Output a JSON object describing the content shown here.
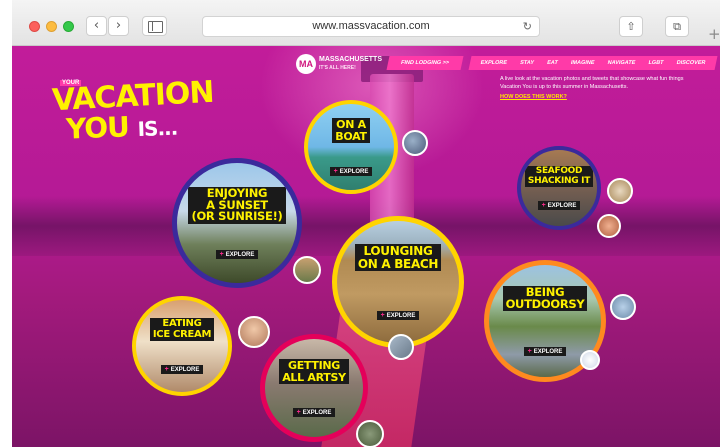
{
  "browser": {
    "url": "www.massvacation.com",
    "back_glyph": "‹",
    "forward_glyph": "›",
    "reload_glyph": "↻",
    "share_glyph": "⇧",
    "tabs_glyph": "⧉",
    "new_tab_glyph": "+"
  },
  "site": {
    "logo": {
      "mark": "MA",
      "name": "MASSACHUSETTS",
      "tagline": "IT'S ALL HERE!"
    },
    "lodging_label": "FIND LODGING >>",
    "nav": [
      "EXPLORE",
      "STAY",
      "EAT",
      "IMAGINE",
      "NAVIGATE",
      "LGBT",
      "DISCOVER"
    ],
    "description": "A live look at the vacation photos and tweets that showcase what fun things Vacation You is up to this summer in Massachusetts.",
    "how_link": "HOW DOES THIS WORK?",
    "hero": {
      "your": "YOUR",
      "line1": "VACATION",
      "line2": "YOU",
      "is": "IS..."
    },
    "explore_label": "EXPLORE",
    "explore_plus": "+",
    "bubbles": [
      {
        "label_line1": "ON A",
        "label_line2": "BOAT"
      },
      {
        "label_line1": "ENJOYING",
        "label_line2": "A SUNSET",
        "label_line3": "(OR SUNRISE!)"
      },
      {
        "label_line1": "SEAFOOD",
        "label_line2": "SHACKING IT"
      },
      {
        "label_line1": "LOUNGING",
        "label_line2": "ON A BEACH"
      },
      {
        "label_line1": "BEING",
        "label_line2": "OUTDOORSY"
      },
      {
        "label_line1": "EATING",
        "label_line2": "ICE CREAM"
      },
      {
        "label_line1": "GETTING",
        "label_line2": "ALL ARTSY"
      }
    ]
  },
  "colors": {
    "background": "#b41a95",
    "accent_pink": "#ff3aa8",
    "headline_yellow": "#fff200",
    "ring_blue": "#3b2a9c",
    "ring_yellow": "#ffd400",
    "ring_orange": "#ff8a1f",
    "ring_red": "#e4005a"
  }
}
